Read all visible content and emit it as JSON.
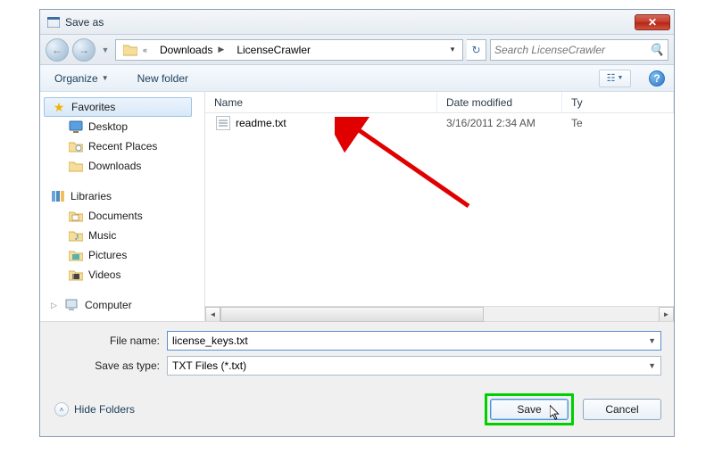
{
  "window": {
    "title": "Save as"
  },
  "address": {
    "segments": [
      "Downloads",
      "LicenseCrawler"
    ],
    "search_placeholder": "Search LicenseCrawler"
  },
  "toolbar": {
    "organize": "Organize",
    "new_folder": "New folder"
  },
  "sidebar": {
    "favorites": {
      "label": "Favorites",
      "items": [
        "Desktop",
        "Recent Places",
        "Downloads"
      ]
    },
    "libraries": {
      "label": "Libraries",
      "items": [
        "Documents",
        "Music",
        "Pictures",
        "Videos"
      ]
    },
    "computer": {
      "label": "Computer"
    }
  },
  "columns": {
    "name": "Name",
    "date": "Date modified",
    "type": "Ty"
  },
  "files": [
    {
      "name": "readme.txt",
      "date": "3/16/2011 2:34 AM",
      "type": "Te"
    }
  ],
  "form": {
    "filename_label": "File name:",
    "filename_value": "license_keys.txt",
    "savetype_label": "Save as type:",
    "savetype_value": "TXT Files (*.txt)"
  },
  "actions": {
    "hide_folders": "Hide Folders",
    "save": "Save",
    "cancel": "Cancel"
  }
}
